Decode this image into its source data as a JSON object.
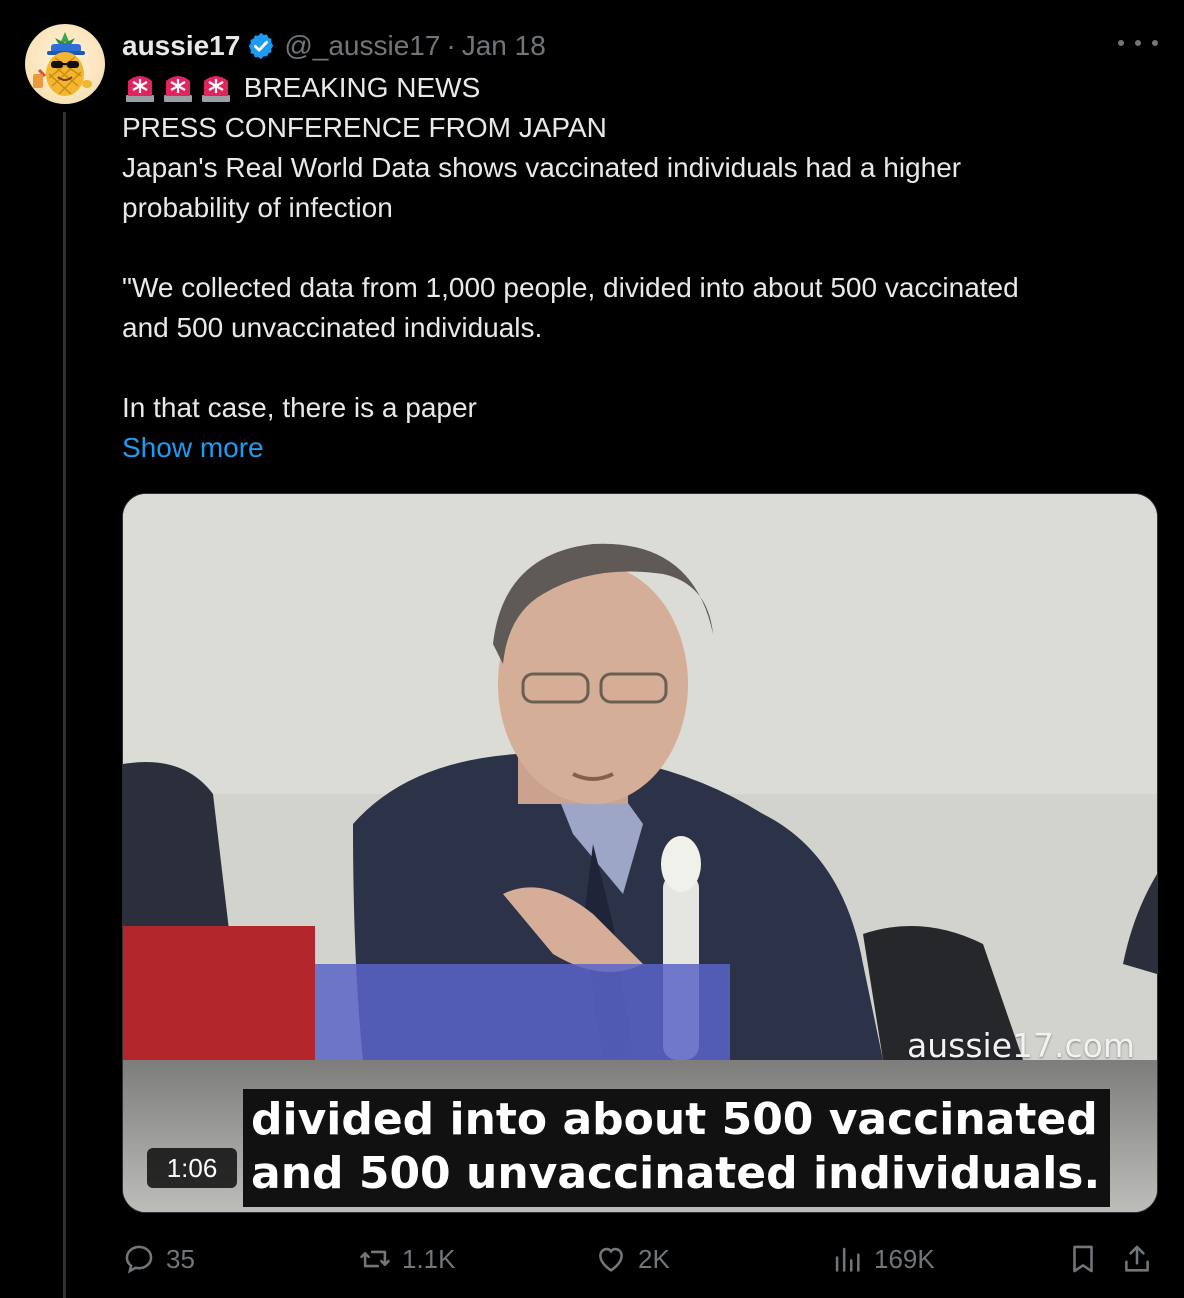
{
  "tweet": {
    "display_name": "aussie17",
    "handle": "@_aussie17",
    "separator": "·",
    "date": "Jan 18",
    "lines": {
      "l1": "BREAKING NEWS",
      "l2": "PRESS CONFERENCE FROM JAPAN",
      "l3": "Japan's Real World Data shows vaccinated individuals had a higher",
      "l4": "probability of infection",
      "l5": "\"We collected data from 1,000 people, divided into about 500 vaccinated",
      "l6": "and 500 unvaccinated individuals.",
      "l7": "In that case, there is a paper"
    },
    "show_more": "Show more",
    "siren_emoji_count": 3
  },
  "video": {
    "watermark": "aussie17.com",
    "caption_line1": "divided into about 500 vaccinated",
    "caption_line2": "and 500 unvaccinated individuals.",
    "duration": "1:06"
  },
  "actions": {
    "replies": "35",
    "reposts": "1.1K",
    "likes": "2K",
    "views": "169K"
  },
  "colors": {
    "background": "#000000",
    "text": "#e7e9ea",
    "muted": "#71767b",
    "link": "#1d9bf0",
    "verified": "#1d9bf0"
  }
}
